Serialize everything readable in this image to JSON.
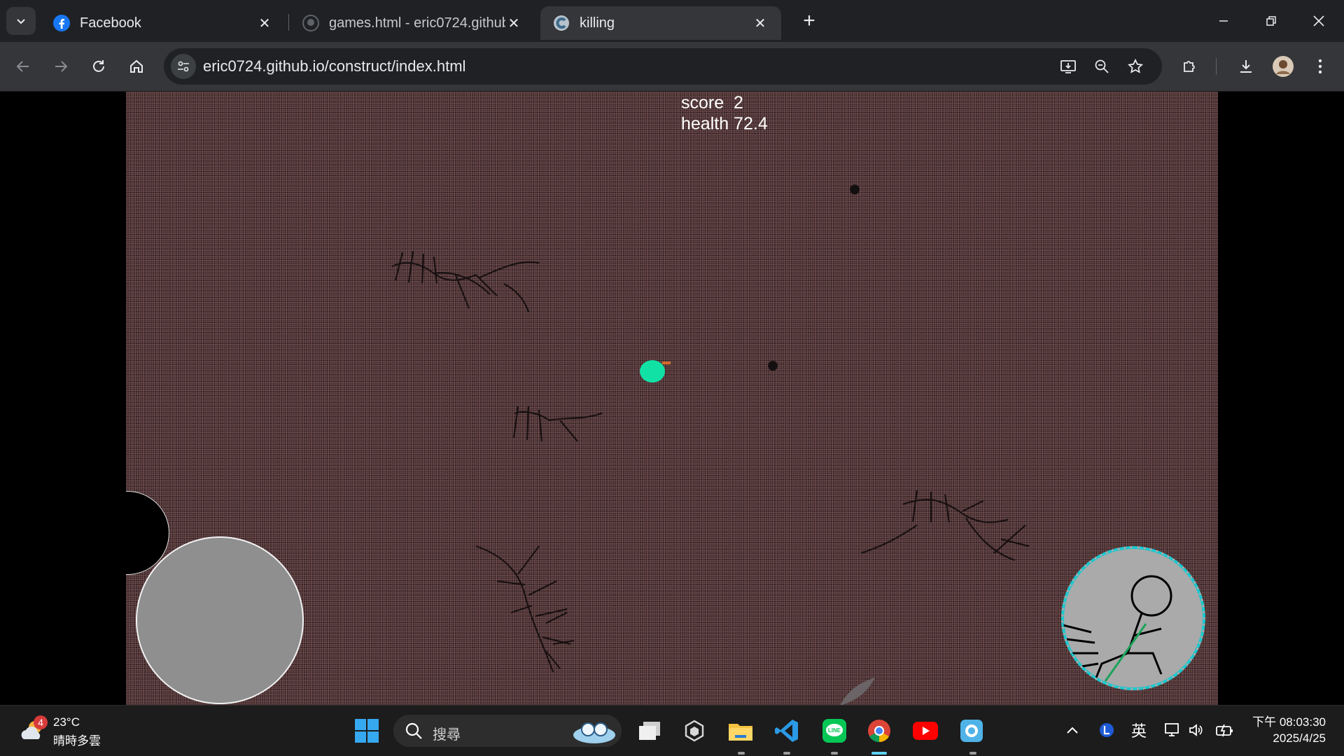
{
  "browser": {
    "tabs": [
      {
        "title": "Facebook",
        "favicon": "facebook-icon",
        "active": false
      },
      {
        "title": "games.html - eric0724.github",
        "favicon": "github-icon",
        "active": false
      },
      {
        "title": "killing",
        "favicon": "construct-icon",
        "active": true
      }
    ],
    "new_tab_label": "+",
    "address": "eric0724.github.io/construct/index.html"
  },
  "game": {
    "score_line": "score  2",
    "health_line": "health 72.4"
  },
  "taskbar": {
    "weather_badge": "4",
    "temperature": "23°C",
    "condition": "晴時多雲",
    "search_placeholder": "搜尋",
    "ime": "英",
    "clock_time": "下午 08:03:30",
    "clock_date": "2025/4/25"
  },
  "colors": {
    "accent_tab": "#35363a",
    "player": "#12e1a6",
    "skill_ring": "#19c8cf",
    "active_indicator": "#5fd1f4"
  }
}
